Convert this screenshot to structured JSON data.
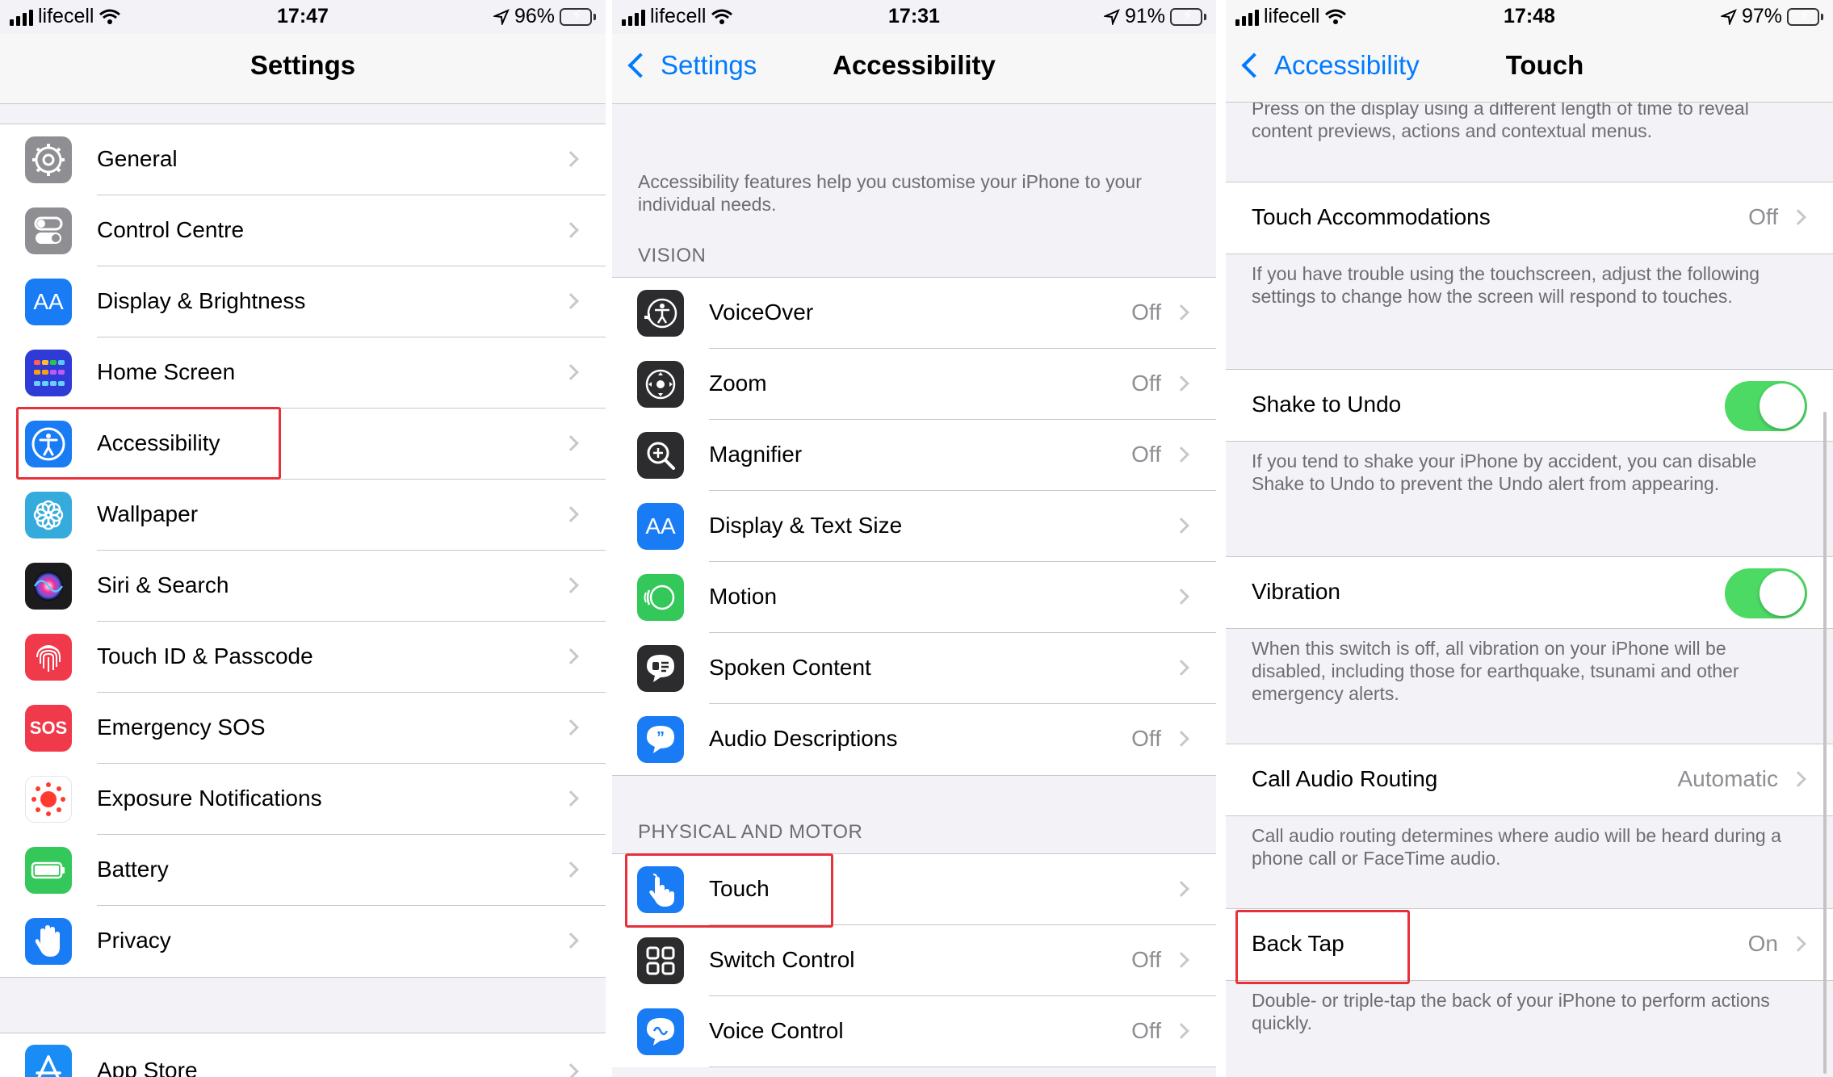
{
  "panel1": {
    "status": {
      "carrier": "lifecell",
      "time": "17:47",
      "battery": "96%",
      "battery_level": 0.96
    },
    "title": "Settings",
    "rows": [
      {
        "label": "General",
        "icon": "gear-icon",
        "color": "#8e8e93"
      },
      {
        "label": "Control Centre",
        "icon": "toggles-icon",
        "color": "#8e8e93"
      },
      {
        "label": "Display & Brightness",
        "icon": "display-aa-icon",
        "color": "#1a7cf5"
      },
      {
        "label": "Home Screen",
        "icon": "home-screen-grid-icon",
        "color": "#2f3bd6"
      },
      {
        "label": "Accessibility",
        "icon": "accessibility-icon",
        "color": "#1a7cf5"
      },
      {
        "label": "Wallpaper",
        "icon": "flower-icon",
        "color": "#35aadc"
      },
      {
        "label": "Siri & Search",
        "icon": "siri-icon",
        "color": "#1c1c1e"
      },
      {
        "label": "Touch ID & Passcode",
        "icon": "fingerprint-icon",
        "color": "#f0394b"
      },
      {
        "label": "Emergency SOS",
        "icon": "sos-icon",
        "color": "#f0394b"
      },
      {
        "label": "Exposure Notifications",
        "icon": "exposure-icon",
        "color": "#ffffff"
      },
      {
        "label": "Battery",
        "icon": "battery-icon",
        "color": "#34c759"
      },
      {
        "label": "Privacy",
        "icon": "hand-icon",
        "color": "#1a7cf5"
      }
    ],
    "app_store": {
      "label": "App Store",
      "icon": "app-store-icon",
      "color": "#1a8cf5"
    }
  },
  "panel2": {
    "status": {
      "carrier": "lifecell",
      "time": "17:31",
      "battery": "91%",
      "battery_level": 0.91
    },
    "back": "Settings",
    "title": "Accessibility",
    "intro": "Accessibility features help you customise your iPhone to your individual needs.",
    "vision_header": "VISION",
    "vision_rows": [
      {
        "label": "VoiceOver",
        "value": "Off",
        "icon": "voiceover-icon",
        "color": "#2c2c2e"
      },
      {
        "label": "Zoom",
        "value": "Off",
        "icon": "zoom-icon",
        "color": "#2c2c2e"
      },
      {
        "label": "Magnifier",
        "value": "Off",
        "icon": "magnifier-icon",
        "color": "#2c2c2e"
      },
      {
        "label": "Display & Text Size",
        "value": "",
        "icon": "display-aa-icon",
        "color": "#1a7cf5"
      },
      {
        "label": "Motion",
        "value": "",
        "icon": "motion-icon",
        "color": "#34c759"
      },
      {
        "label": "Spoken Content",
        "value": "",
        "icon": "spoken-content-icon",
        "color": "#2c2c2e"
      },
      {
        "label": "Audio Descriptions",
        "value": "Off",
        "icon": "audio-descriptions-icon",
        "color": "#1a7cf5"
      }
    ],
    "motor_header": "PHYSICAL AND MOTOR",
    "motor_rows": [
      {
        "label": "Touch",
        "value": "",
        "icon": "touch-hand-icon",
        "color": "#1a7cf5"
      },
      {
        "label": "Switch Control",
        "value": "Off",
        "icon": "switch-control-icon",
        "color": "#2c2c2e"
      },
      {
        "label": "Voice Control",
        "value": "Off",
        "icon": "voice-control-icon",
        "color": "#1a7cf5"
      }
    ]
  },
  "panel3": {
    "status": {
      "carrier": "lifecell",
      "time": "17:48",
      "battery": "97%",
      "battery_level": 0.97
    },
    "back": "Accessibility",
    "title": "Touch",
    "top_footer": "Press on the display using a different length of time to reveal content previews, actions and contextual menus.",
    "touch_accommodations": {
      "label": "Touch Accommodations",
      "value": "Off"
    },
    "touch_accommodations_footer": "If you have trouble using the touchscreen, adjust the following settings to change how the screen will respond to touches.",
    "shake_to_undo": {
      "label": "Shake to Undo",
      "on": true
    },
    "shake_footer": "If you tend to shake your iPhone by accident, you can disable Shake to Undo to prevent the Undo alert from appearing.",
    "vibration": {
      "label": "Vibration",
      "on": true
    },
    "vibration_footer": "When this switch is off, all vibration on your iPhone will be disabled, including those for earthquake, tsunami and other emergency alerts.",
    "call_audio": {
      "label": "Call Audio Routing",
      "value": "Automatic"
    },
    "call_audio_footer": "Call audio routing determines where audio will be heard during a phone call or FaceTime audio.",
    "back_tap": {
      "label": "Back Tap",
      "value": "On"
    },
    "back_tap_footer": "Double- or triple-tap the back of your iPhone to perform actions quickly."
  },
  "colors": {
    "accent": "#007aff",
    "highlight": "#e8303a",
    "toggle_on": "#4cd964"
  }
}
